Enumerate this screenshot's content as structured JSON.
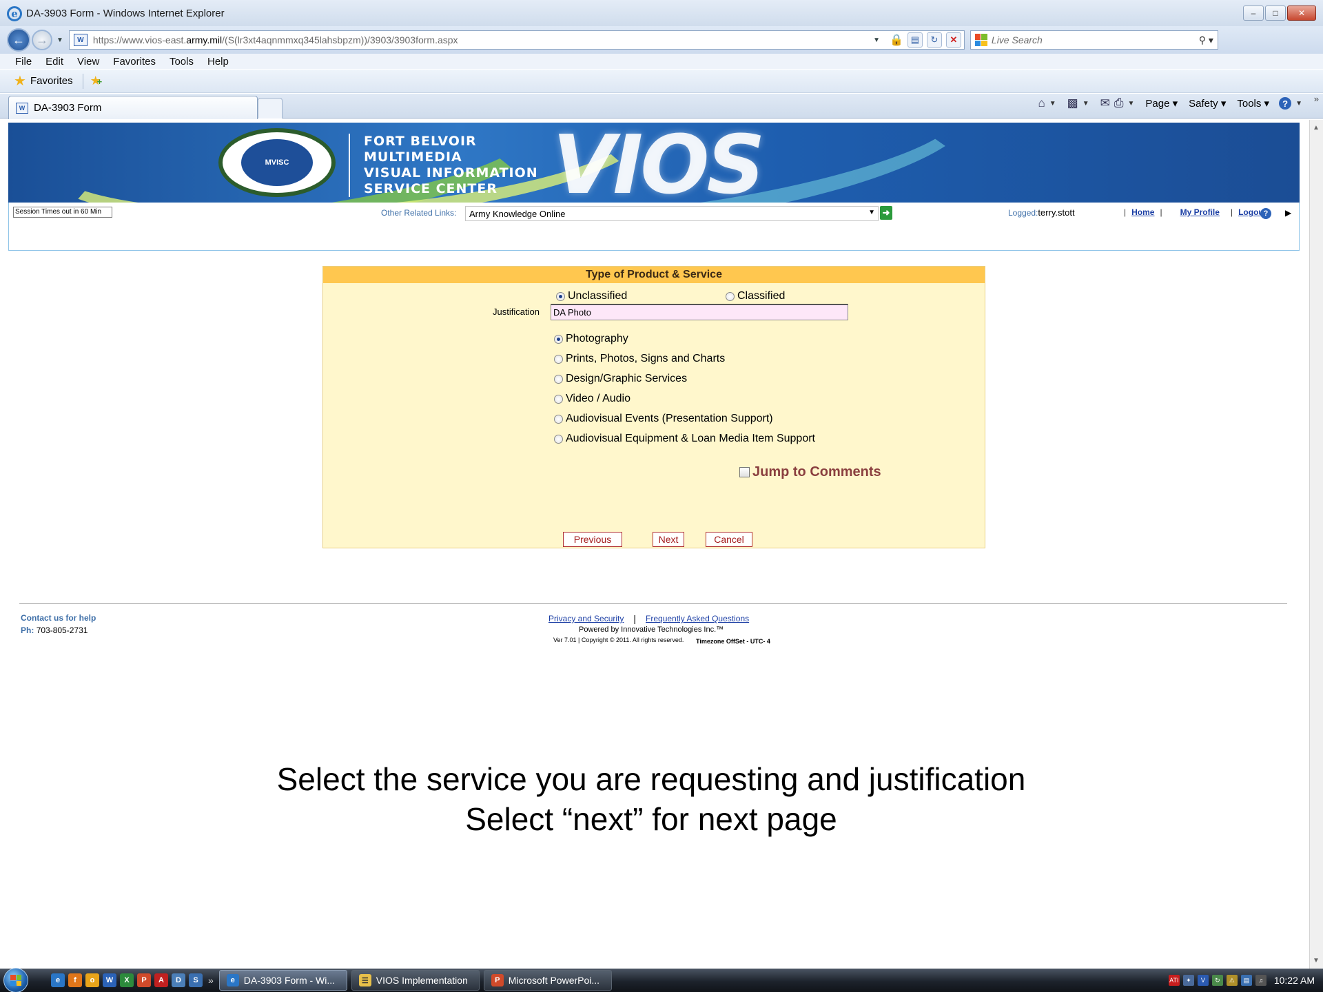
{
  "window": {
    "title": "DA-3903 Form - Windows Internet Explorer",
    "controls": [
      "–",
      "□",
      "✕"
    ]
  },
  "address": {
    "url_prefix": "https://www.vios-east.",
    "url_domain": "army.mil",
    "url_rest": "/(S(lr3xt4aqnmmxq345lahsbpzm))/3903/3903form.aspx",
    "search_placeholder": "Live Search"
  },
  "menu": [
    "File",
    "Edit",
    "View",
    "Favorites",
    "Tools",
    "Help"
  ],
  "favorites": {
    "label": "Favorites"
  },
  "tab": {
    "label": "DA-3903 Form"
  },
  "commands": {
    "page": "Page",
    "safety": "Safety",
    "tools": "Tools"
  },
  "banner": {
    "seal_text": "MVISC",
    "lines": [
      "FORT BELVOIR",
      "MULTIMEDIA",
      "VISUAL INFORMATION",
      "SERVICE CENTER"
    ],
    "logo_text": "VIOS"
  },
  "header": {
    "session": "Session Times out in 60 Min",
    "other_links_label": "Other Related Links:",
    "other_links_value": "Army Knowledge Online",
    "logged_label": "Logged:",
    "logged_user": "terry.stott",
    "home": "Home",
    "my_profile": "My Profile",
    "logout": "Logout"
  },
  "form": {
    "title": "Type of Product & Service",
    "classification": [
      {
        "label": "Unclassified",
        "selected": true
      },
      {
        "label": "Classified",
        "selected": false
      }
    ],
    "justification_label": "Justification",
    "justification_value": "DA Photo",
    "services": [
      {
        "label": "Photography",
        "selected": true
      },
      {
        "label": "Prints, Photos, Signs and Charts",
        "selected": false
      },
      {
        "label": "Design/Graphic Services",
        "selected": false
      },
      {
        "label": "Video / Audio",
        "selected": false
      },
      {
        "label": "Audiovisual Events (Presentation Support)",
        "selected": false
      },
      {
        "label": "Audiovisual Equipment & Loan Media Item Support",
        "selected": false
      }
    ],
    "jump_to_comments": "Jump to Comments",
    "buttons": {
      "previous": "Previous",
      "next": "Next",
      "cancel": "Cancel"
    }
  },
  "footer": {
    "contact": "Contact us for help",
    "phone_label": "Ph:",
    "phone": "703-805-2731",
    "privacy": "Privacy and Security",
    "faq": "Frequently Asked Questions",
    "powered": "Powered by Innovative Technologies Inc.™",
    "version": "Ver 7.01 | Copyright © 2011. All rights reserved.",
    "timezone": "Timezone OffSet - UTC- 4"
  },
  "caption": {
    "line1": "Select the service you are requesting and justification",
    "line2": "Select “next” for next page"
  },
  "taskbar": {
    "tasks": [
      {
        "label": "DA-3903 Form - Wi...",
        "active": true
      },
      {
        "label": "VIOS Implementation",
        "active": false
      },
      {
        "label": "Microsoft PowerPoi...",
        "active": false
      }
    ],
    "clock": "10:22 AM"
  }
}
